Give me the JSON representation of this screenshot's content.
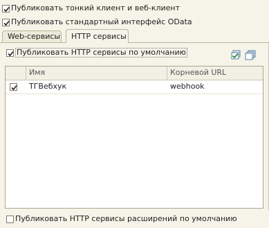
{
  "options": {
    "publish_thin_client": {
      "label": "Публиковать тонкий клиент и веб-клиент",
      "checked": true
    },
    "publish_odata": {
      "label": "Публиковать стандартный интерфейс OData",
      "checked": true
    }
  },
  "tabs": [
    {
      "label": "Web-сервисы",
      "active": false
    },
    {
      "label": "HTTP сервисы",
      "active": true
    }
  ],
  "http_panel": {
    "publish_default": {
      "label": "Публиковать HTTP сервисы по умолчанию",
      "checked": true
    },
    "toolbar": {
      "check_all_icon": "check-all-icon",
      "uncheck_all_icon": "uncheck-all-icon"
    },
    "table": {
      "columns": [
        "",
        "Имя",
        "Корневой URL"
      ],
      "rows": [
        {
          "checked": true,
          "name": "ТГВебхук",
          "root_url": "webhook"
        }
      ]
    },
    "publish_extensions": {
      "label": "Публиковать HTTP сервисы расширений по умолчанию",
      "checked": false
    }
  }
}
